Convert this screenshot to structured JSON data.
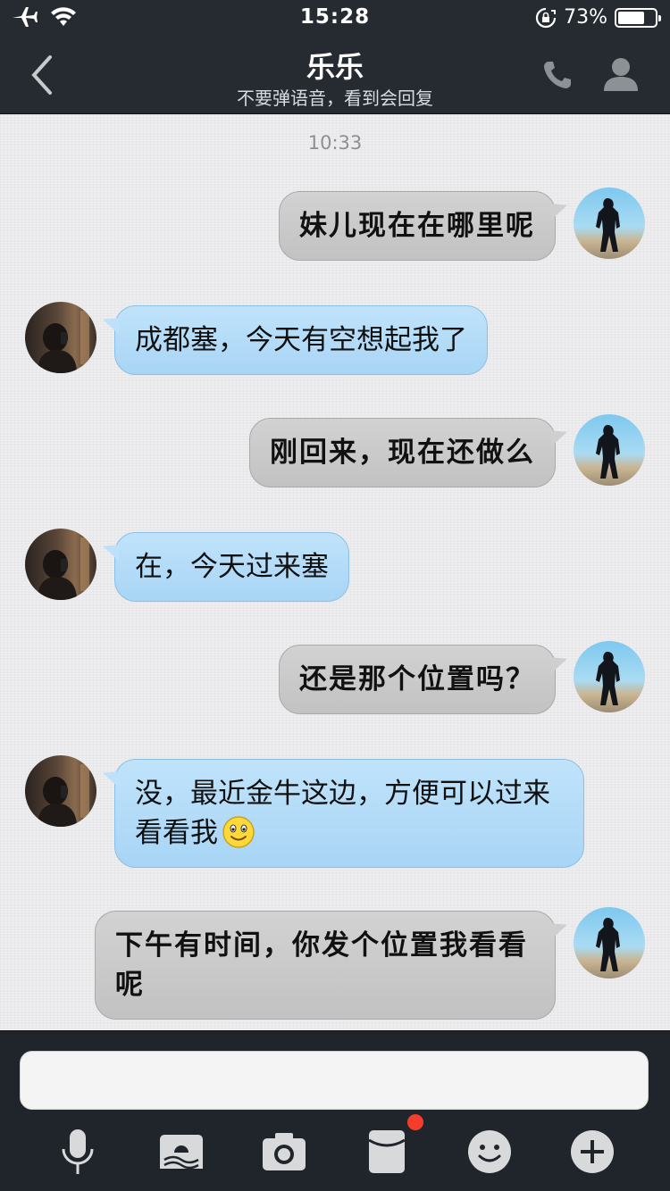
{
  "status_bar": {
    "time": "15:28",
    "battery": "73%",
    "battery_level": 0.73,
    "icons": [
      "airplane-icon",
      "wifi-icon",
      "rotation-lock-icon",
      "battery-icon"
    ]
  },
  "nav": {
    "title": "乐乐",
    "subtitle": "不要弹语音，看到会回复",
    "icons": [
      "back-icon",
      "phone-icon",
      "profile-icon"
    ]
  },
  "chat": {
    "timestamp": "10:33",
    "messages": [
      {
        "sender": "self",
        "text": "妹儿现在在哪里呢"
      },
      {
        "sender": "friend",
        "text": "成都塞，今天有空想起我了"
      },
      {
        "sender": "self",
        "text": "刚回来，现在还做么"
      },
      {
        "sender": "friend",
        "text": "在，今天过来塞"
      },
      {
        "sender": "self",
        "text": "还是那个位置吗？"
      },
      {
        "sender": "friend",
        "text": "没，最近金牛这边，方便可以过来看看我",
        "emoji": "smile-emoji-icon"
      },
      {
        "sender": "self",
        "text": "下午有时间，你发个位置我看看呢"
      }
    ]
  },
  "input": {
    "value": "",
    "toolbar": [
      "microphone-icon",
      "image-icon",
      "camera-icon",
      "red-packet-icon",
      "emoji-icon",
      "plus-icon"
    ]
  },
  "colors": {
    "header_bg": "#262b31",
    "chat_bg": "#eaeaec",
    "self_bubble": "#c9c9c9",
    "friend_bubble": "#b4dbf7",
    "badge": "#f53d2c"
  }
}
